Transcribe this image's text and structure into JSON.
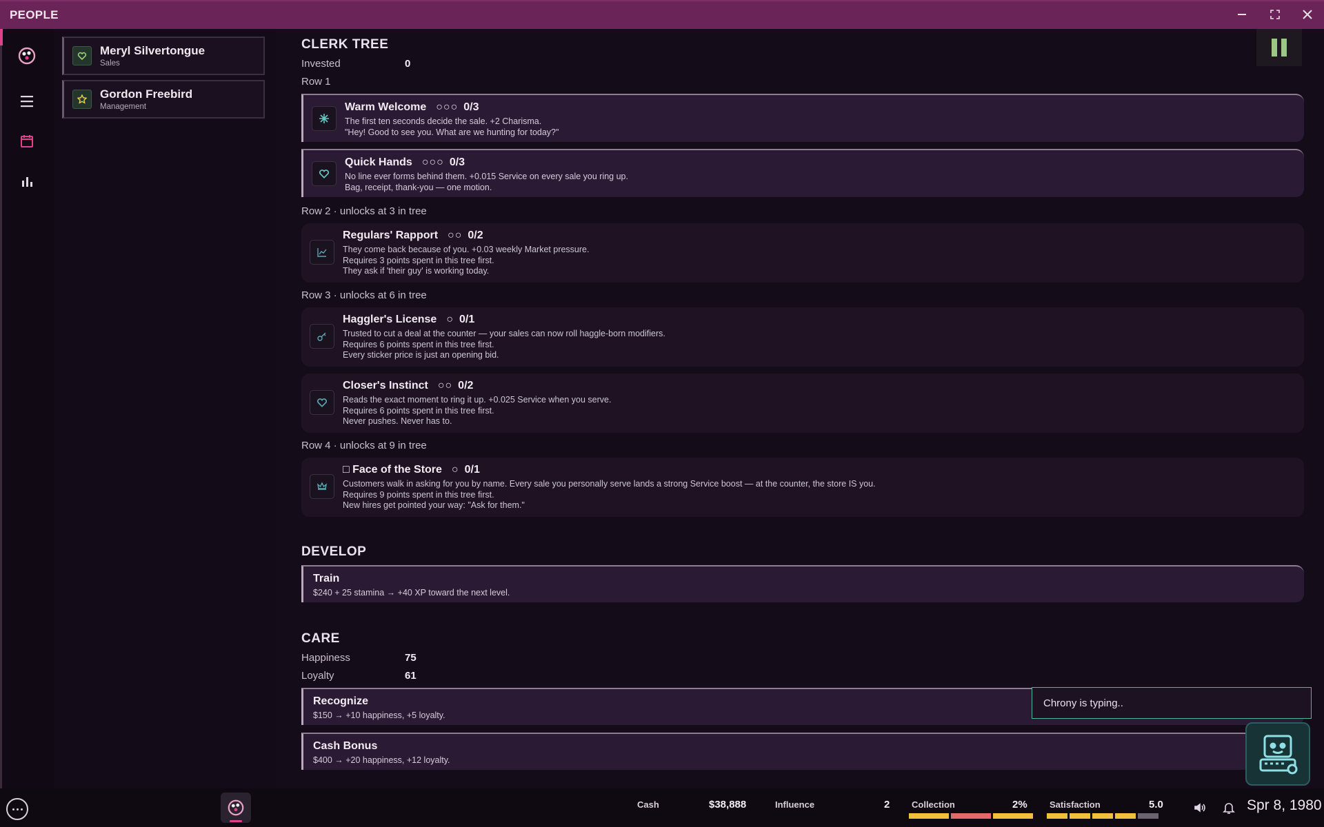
{
  "window": {
    "title": "PEOPLE"
  },
  "rail": {
    "icons": [
      "people-icon",
      "menu-icon",
      "calendar-icon",
      "stats-icon"
    ]
  },
  "people": [
    {
      "name": "Meryl Silvertongue",
      "role": "Sales",
      "icon": "heart-icon"
    },
    {
      "name": "Gordon Freebird",
      "role": "Management",
      "icon": "star-icon"
    }
  ],
  "clerk_tree": {
    "title": "CLERK TREE",
    "invested_label": "Invested",
    "invested_value": "0",
    "rows": [
      {
        "label": "Row 1"
      },
      {
        "label": "Row 2 · unlocks at 3 in tree"
      },
      {
        "label": "Row 3 · unlocks at 6 in tree"
      },
      {
        "label": "Row 4 · unlocks at 9 in tree"
      }
    ],
    "skills": [
      {
        "title": "Warm Welcome",
        "dots": "○○○",
        "rank": "0/3",
        "icon": "sparkle-icon",
        "lines": [
          "The first ten seconds decide the sale. +2 Charisma.",
          "\"Hey! Good to see you. What are we hunting for today?\""
        ]
      },
      {
        "title": "Quick Hands",
        "dots": "○○○",
        "rank": "0/3",
        "icon": "heart-icon",
        "lines": [
          "No line ever forms behind them. +0.015 Service on every sale you ring up.",
          "Bag, receipt, thank-you — one motion."
        ]
      },
      {
        "title": "Regulars' Rapport",
        "dots": "○○",
        "rank": "0/2",
        "icon": "chart-line-icon",
        "lines": [
          "They come back because of you. +0.03 weekly Market pressure.",
          "Requires 3 points spent in this tree first.",
          "They ask if 'their guy' is working today."
        ]
      },
      {
        "title": "Haggler's License",
        "dots": "○",
        "rank": "0/1",
        "icon": "key-icon",
        "lines": [
          "Trusted to cut a deal at the counter — your sales can now roll haggle-born modifiers.",
          "Requires 6 points spent in this tree first.",
          "Every sticker price is just an opening bid."
        ]
      },
      {
        "title": "Closer's Instinct",
        "dots": "○○",
        "rank": "0/2",
        "icon": "heart-icon",
        "lines": [
          "Reads the exact moment to ring it up. +0.025 Service when you serve.",
          "Requires 6 points spent in this tree first.",
          "Never pushes. Never has to."
        ]
      },
      {
        "title": "□ Face of the Store",
        "dots": "○",
        "rank": "0/1",
        "icon": "crown-icon",
        "lines": [
          "Customers walk in asking for you by name. Every sale you personally serve lands a strong Service boost — at the counter, the store IS you.",
          "Requires 9 points spent in this tree first.",
          "New hires get pointed your way: \"Ask for them.\""
        ]
      }
    ]
  },
  "develop": {
    "title": "DEVELOP",
    "train": {
      "title": "Train",
      "desc": "$240 + 25 stamina  →  +40 XP toward the next level."
    }
  },
  "care": {
    "title": "CARE",
    "happiness_label": "Happiness",
    "happiness_value": "75",
    "loyalty_label": "Loyalty",
    "loyalty_value": "61",
    "recognize": {
      "title": "Recognize",
      "desc": "$150  →  +10 happiness, +5 loyalty."
    },
    "cash_bonus": {
      "title": "Cash Bonus",
      "desc": "$400  →  +20 happiness, +12 loyalty."
    }
  },
  "toast": {
    "text": "Chrony is typing.."
  },
  "taskbar": {
    "cash_label": "Cash",
    "cash_value": "$38,888",
    "influence_label": "Influence",
    "influence_value": "2",
    "collection_label": "Collection",
    "collection_value": "2%",
    "collection_fraction": 0.02,
    "satisfaction_label": "Satisfaction",
    "satisfaction_value": "5.0",
    "date": "Spr 8, 1980"
  },
  "colors": {
    "titlebar": "#6a2458",
    "accent_pink": "#e0408c",
    "pause_green": "#9dc884",
    "meter_yellow": "#f0bf3c",
    "meter_red": "#e26a6a",
    "meter_gray": "#6b6470"
  }
}
